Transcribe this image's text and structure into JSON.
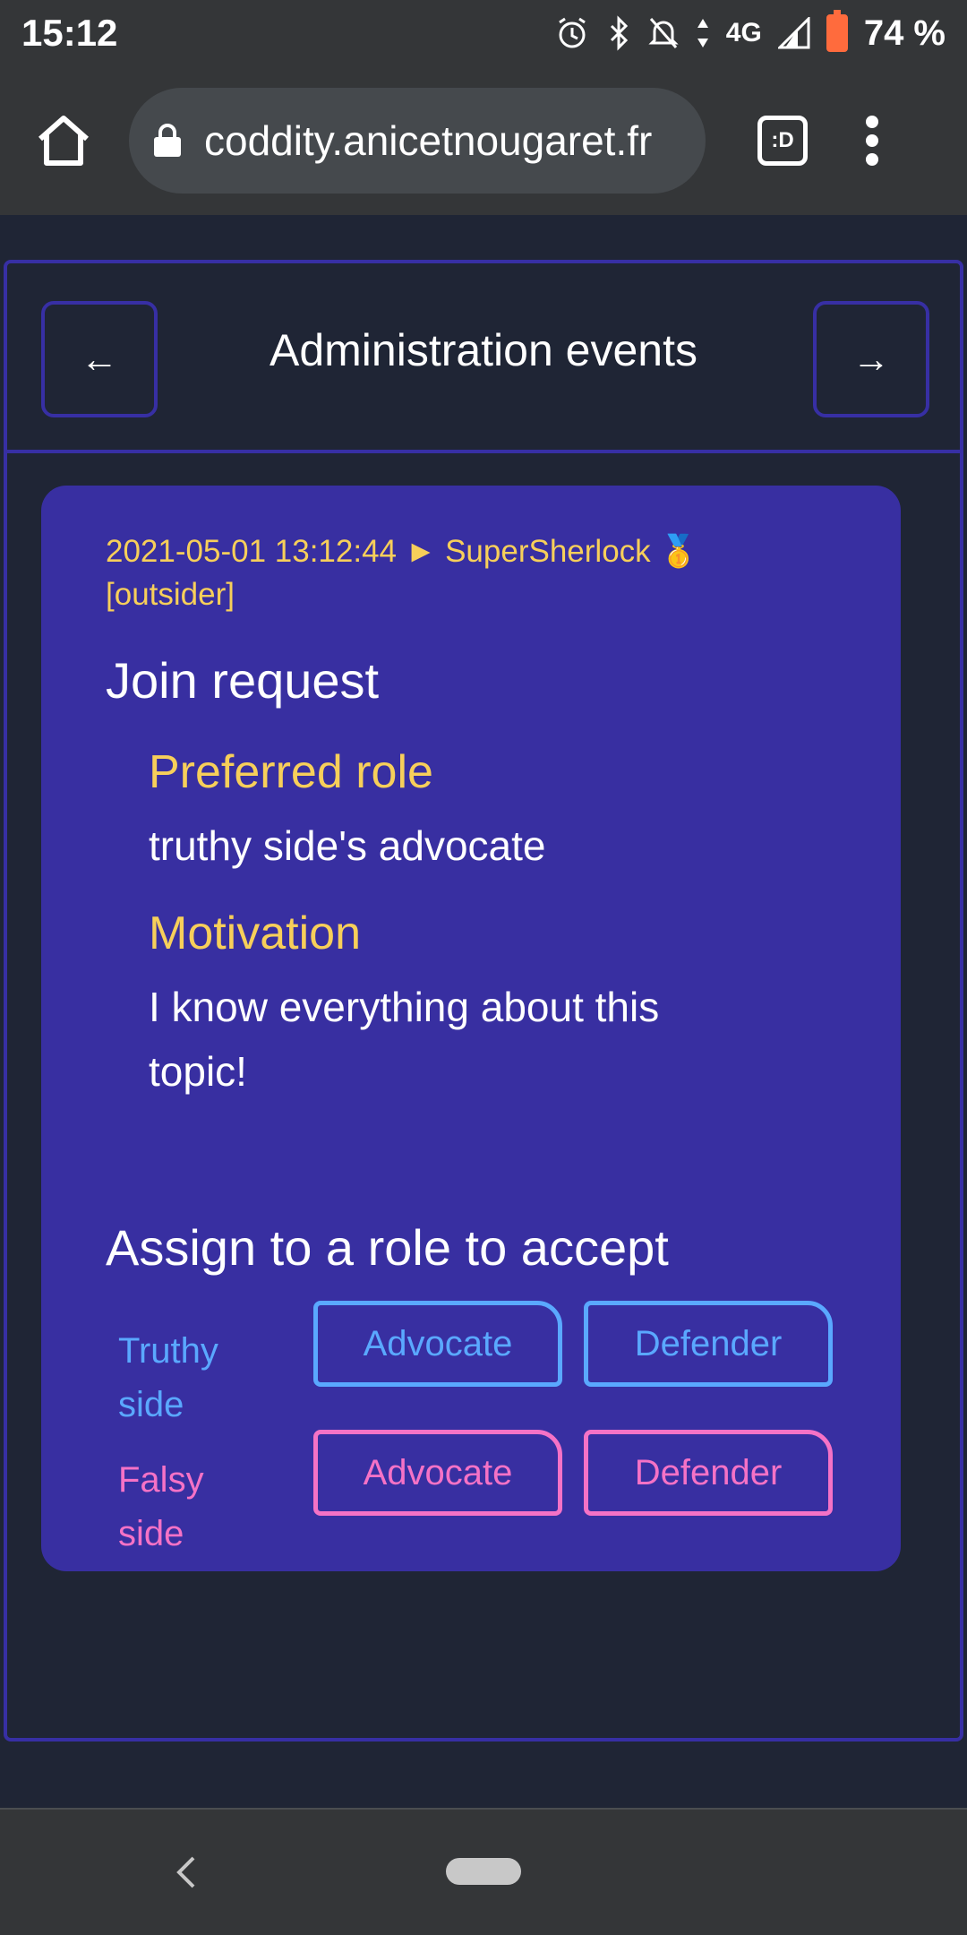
{
  "status_bar": {
    "time": "15:12",
    "network": "4G",
    "battery": "74 %",
    "icons": [
      "alarm-icon",
      "bluetooth-icon",
      "mute-icon",
      "data-arrows-icon",
      "signal-icon",
      "battery-icon"
    ]
  },
  "browser": {
    "url": "coddity.anicetnougaret.fr",
    "tabs_label": ":D"
  },
  "header": {
    "prev_label": "←",
    "title": "Administration events",
    "next_label": "→"
  },
  "event": {
    "meta": "2021-05-01 13:12:44 ► SuperSherlock 🥇 [outsider]",
    "heading": "Join request",
    "preferred_role_label": "Preferred role",
    "preferred_role_value": "truthy side's advocate",
    "motivation_label": "Motivation",
    "motivation_value": "I know everything about this topic!",
    "assign_heading": "Assign to a role to accept",
    "truthy": {
      "label": "Truthy side",
      "advocate": "Advocate",
      "defender": "Defender"
    },
    "falsy": {
      "label": "Falsy side",
      "advocate": "Advocate",
      "defender": "Defender"
    }
  },
  "colors": {
    "accent_border": "#372fa4",
    "card_bg": "#382fa1",
    "highlight": "#f7cf5a",
    "truthy": "#5aa8ff",
    "falsy": "#f572c6"
  }
}
